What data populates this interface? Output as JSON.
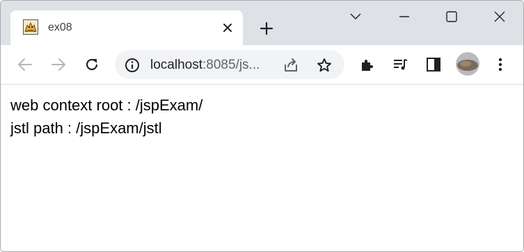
{
  "window": {
    "controls": [
      "chevron-down",
      "minimize",
      "maximize",
      "close"
    ]
  },
  "tab": {
    "title": "ex08",
    "favicon": "tomcat-icon"
  },
  "toolbar": {
    "url_host": "localhost",
    "url_rest": ":8085/js...",
    "icons": [
      "back-arrow-icon",
      "forward-arrow-icon",
      "reload-icon",
      "info-icon",
      "share-icon",
      "star-icon",
      "extensions-icon",
      "media-icon",
      "side-panel-icon",
      "avatar",
      "menu-icon"
    ]
  },
  "page": {
    "line1": "web context root : /jspExam/",
    "line2": "jstl path : /jspExam/jstl"
  },
  "colors": {
    "titlebar_bg": "#dee1e6",
    "omnibox_bg": "#f1f3f4",
    "icon": "#5f6368",
    "icon_disabled": "#b4b7bb"
  }
}
